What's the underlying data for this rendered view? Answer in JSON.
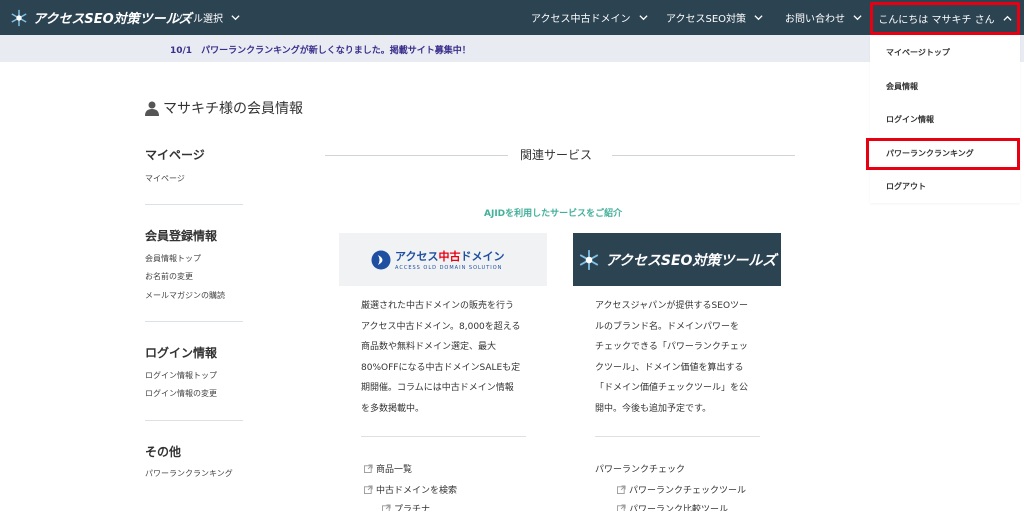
{
  "header": {
    "logo_text": "アクセスSEO対策ツールズ",
    "nav": [
      {
        "label": "ツール選択"
      },
      {
        "label": "アクセス中古ドメイン"
      },
      {
        "label": "アクセスSEO対策"
      },
      {
        "label": "お問い合わせ"
      }
    ],
    "greeting": "こんにちは マサキチ さん"
  },
  "notice": "10/1　パワーランクランキングが新しくなりました。掲載サイト募集中！",
  "page_title": "マサキチ様の会員情報",
  "sidebar": {
    "sections": [
      {
        "heading": "マイページ",
        "links": [
          "マイページ"
        ]
      },
      {
        "heading": "会員登録情報",
        "links": [
          "会員情報トップ",
          "お名前の変更",
          "メールマガジンの購読"
        ]
      },
      {
        "heading": "ログイン情報",
        "links": [
          "ログイン情報トップ",
          "ログイン情報の変更"
        ]
      },
      {
        "heading": "その他",
        "links": [
          "パワーランクランキング"
        ]
      }
    ]
  },
  "main": {
    "section_title": "関連サービス",
    "intro": "AJIDを利用したサービスをご紹介",
    "card1": {
      "banner_main_a": "アクセス",
      "banner_main_b": "中古",
      "banner_main_c": "ドメイン",
      "banner_sub": "ACCESS OLD DOMAIN SOLUTION",
      "desc_lines": [
        "厳選された中古ドメインの販売を行う",
        "アクセス中古ドメイン。8,000を超える",
        "商品数や無料ドメイン選定、最大",
        "80%OFFになる中古ドメインSALEも定",
        "期開催。コラムには中古ドメイン情報",
        "を多数掲載中。"
      ],
      "links": [
        "商品一覧",
        "中古ドメインを検索",
        "プラチナ"
      ]
    },
    "card2": {
      "banner_text": "アクセスSEO対策ツールズ",
      "desc_lines": [
        "アクセスジャパンが提供するSEOツー",
        "ルのブランド名。ドメインパワーを",
        "チェックできる「パワーランクチェッ",
        "クツール」、ドメイン価値を算出する",
        "「ドメイン価値チェックツール」を公",
        "開中。今後も追加予定です。"
      ],
      "links_heading": "パワーランクチェック",
      "links": [
        "パワーランクチェックツール",
        "パワーランク比較ツール"
      ]
    }
  },
  "dropdown": {
    "items": [
      "マイページトップ",
      "会員情報",
      "ログイン情報",
      "パワーランクランキング",
      "ログアウト"
    ]
  },
  "colors": {
    "header_bg": "#2c4352",
    "highlight": "#e60012",
    "accent_green": "#43b09a",
    "notice_text": "#3b2f8c"
  }
}
